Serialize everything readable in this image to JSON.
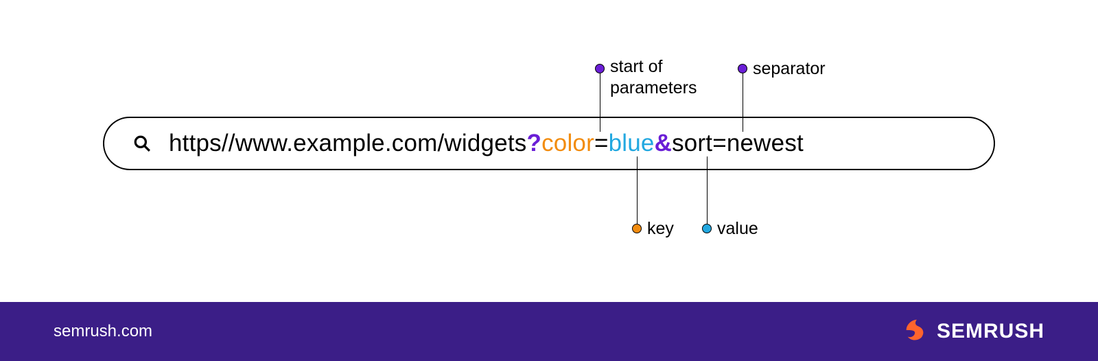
{
  "url_parts": {
    "base": "https//www.example.com/widgets",
    "qmark": "?",
    "key1": "color",
    "eq1": "=",
    "val1": "blue",
    "amp": "&",
    "rest": "sort=newest"
  },
  "annotations": {
    "start_line1": "start of",
    "start_line2": "parameters",
    "separator": "separator",
    "key": "key",
    "value": "value"
  },
  "footer": {
    "site": "semrush.com",
    "brand": "SEMRUSH"
  },
  "colors": {
    "purple": "#6a1ed6",
    "orange": "#f28c0f",
    "blue": "#22a8e0",
    "footer_bg": "#3b1e87",
    "brand_orange": "#ff642d"
  }
}
